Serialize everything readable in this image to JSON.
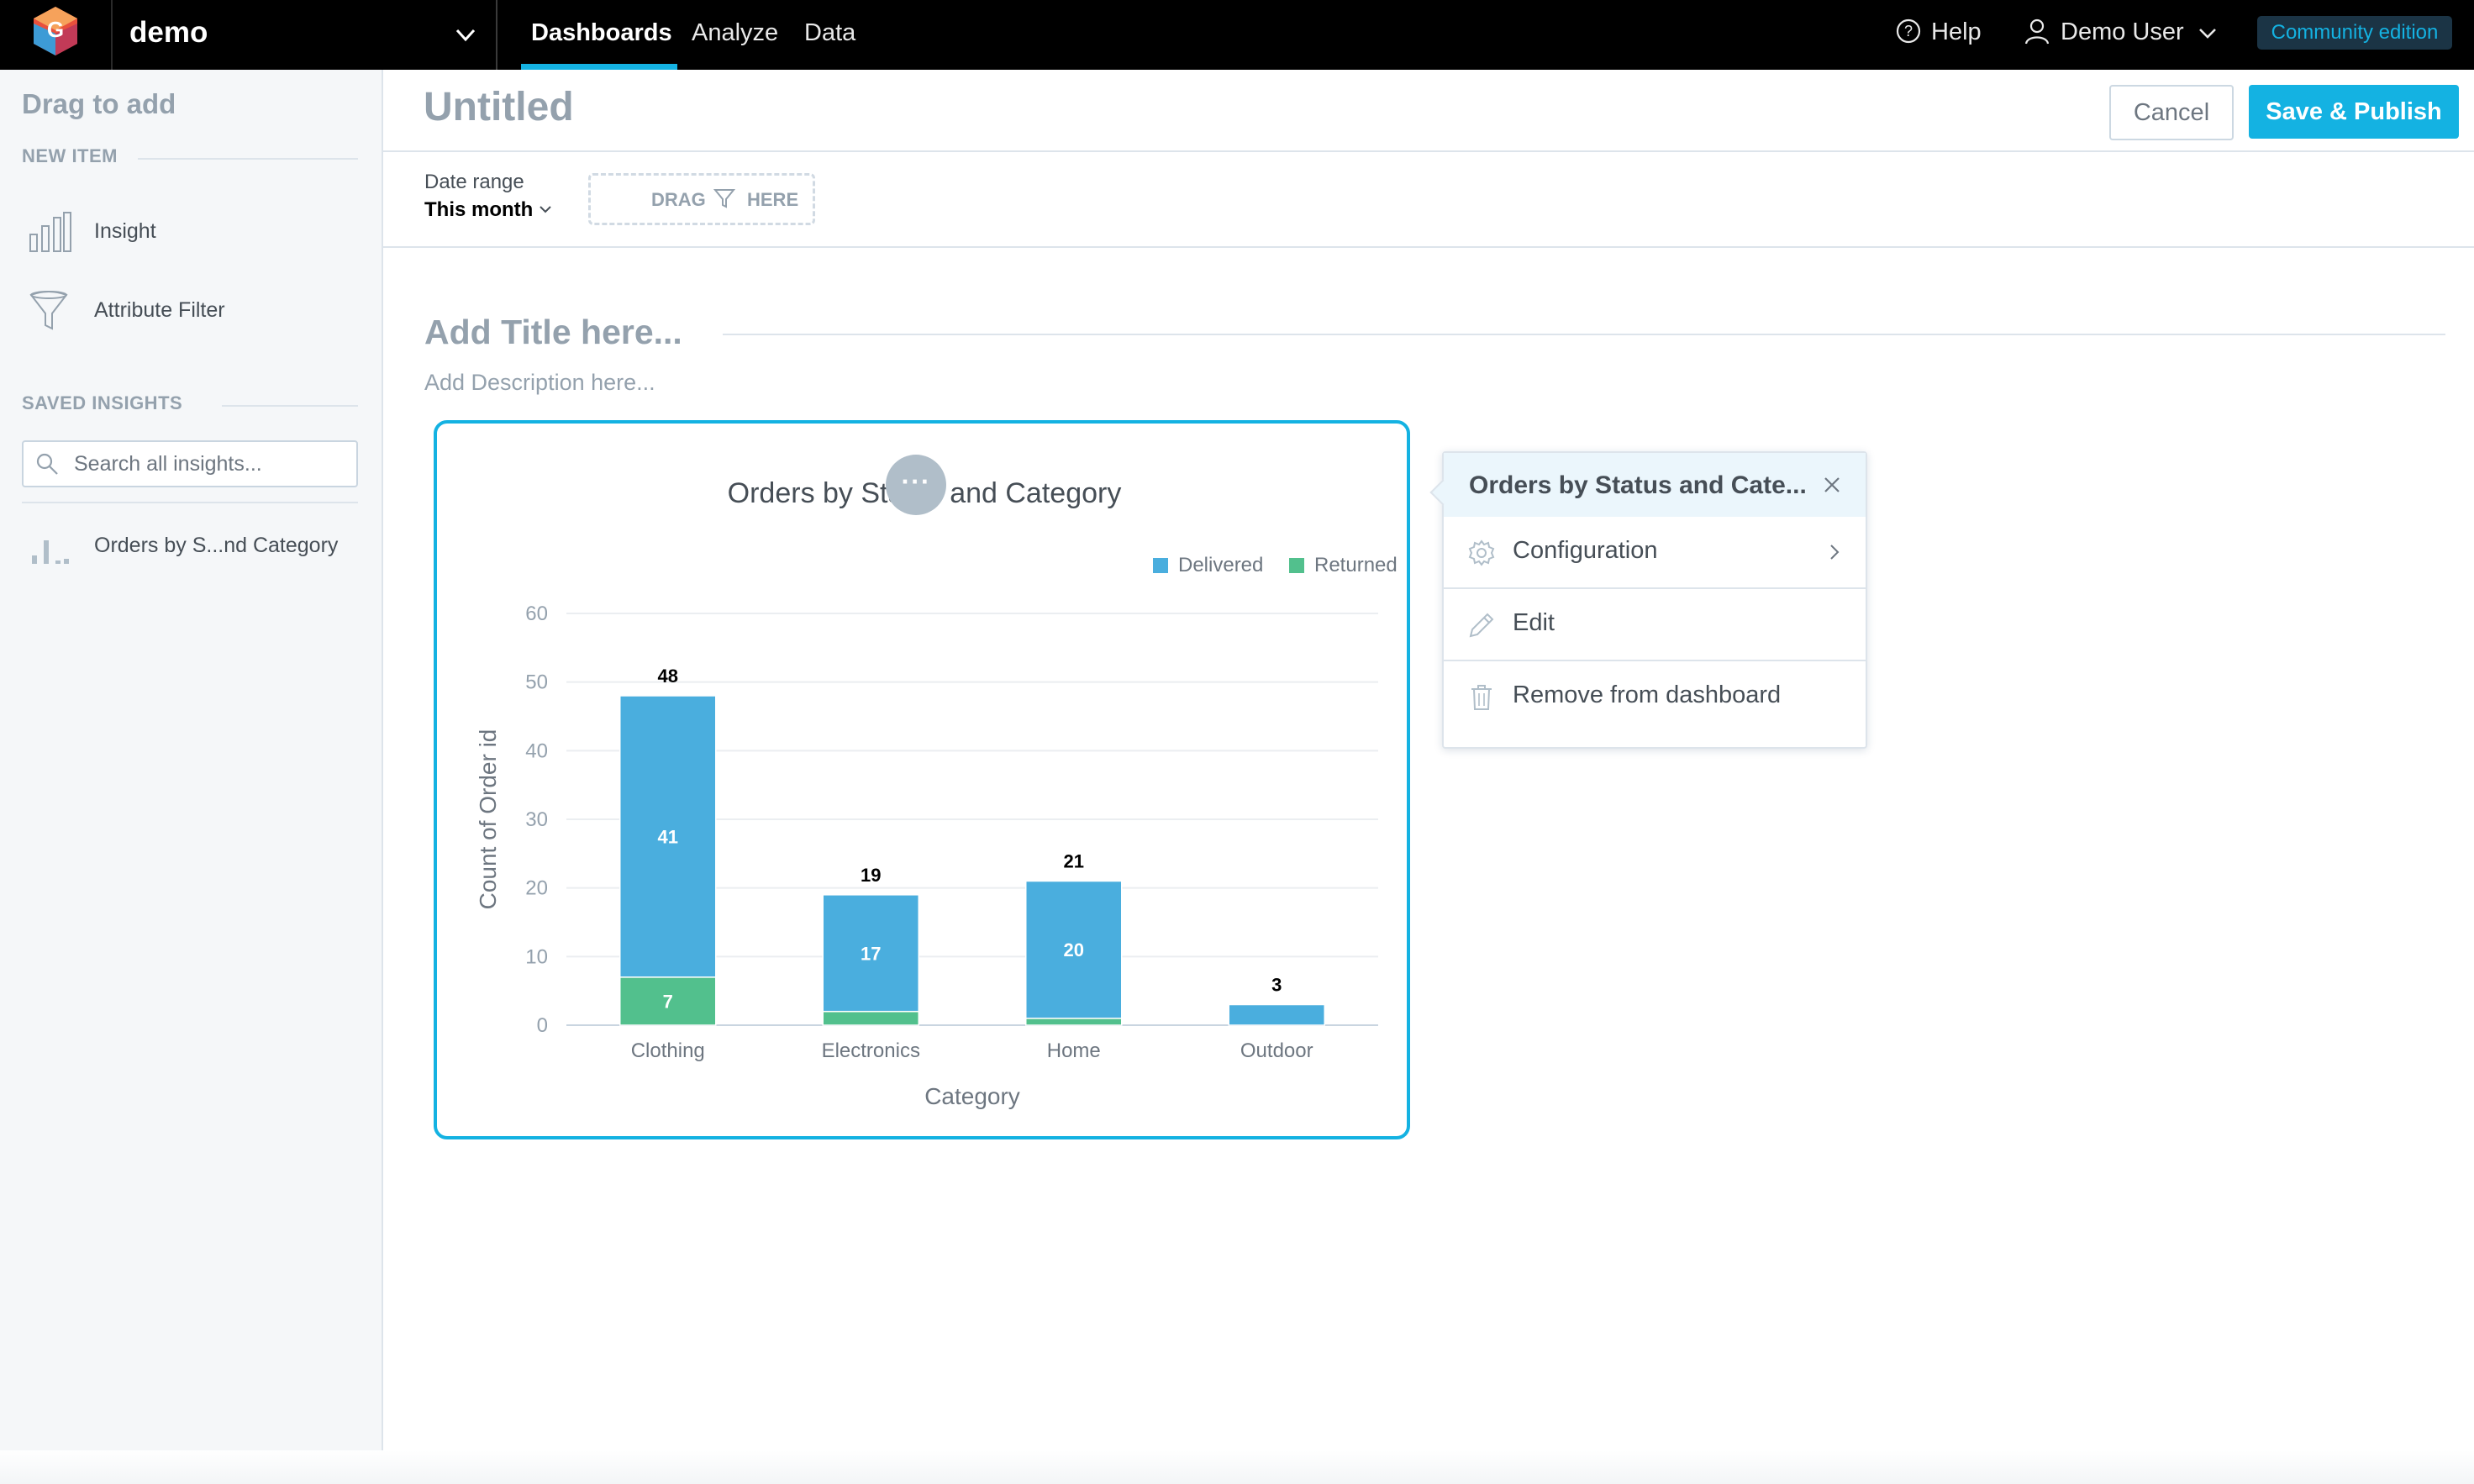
{
  "topbar": {
    "workspace": "demo",
    "tabs": [
      "Dashboards",
      "Analyze",
      "Data"
    ],
    "help": "Help",
    "user": "Demo User",
    "badge": "Community edition"
  },
  "sidebar": {
    "title": "Drag to add",
    "new_item_heading": "NEW ITEM",
    "new_items": [
      "Insight",
      "Attribute Filter"
    ],
    "saved_heading": "SAVED INSIGHTS",
    "search_placeholder": "Search all insights...",
    "saved_items": [
      "Orders by S...nd Category"
    ]
  },
  "header": {
    "title": "Untitled",
    "cancel": "Cancel",
    "save": "Save & Publish"
  },
  "filters": {
    "date_label": "Date range",
    "date_value": "This month",
    "drag_word": "DRAG",
    "here_word": "HERE"
  },
  "section": {
    "title_placeholder": "Add Title here...",
    "description_placeholder": "Add Description here..."
  },
  "widget": {
    "title": "Orders by Status and Category",
    "menu_label": "···"
  },
  "popup": {
    "title": "Orders by Status and Cate...",
    "items": [
      "Configuration",
      "Edit",
      "Remove from dashboard"
    ]
  },
  "colors": {
    "accent": "#14b2e2",
    "delivered": "#4aaede",
    "returned": "#52c08d",
    "topbar": "#000000"
  },
  "chart_data": {
    "type": "bar",
    "stacked": true,
    "categories": [
      "Clothing",
      "Electronics",
      "Home",
      "Outdoor"
    ],
    "series": [
      {
        "name": "Delivered",
        "values": [
          41,
          17,
          20,
          3
        ],
        "labels": [
          "41",
          "17",
          "20",
          ""
        ]
      },
      {
        "name": "Returned",
        "values": [
          7,
          2,
          1,
          0
        ],
        "labels": [
          "7",
          "",
          "",
          ""
        ]
      }
    ],
    "totals": [
      48,
      19,
      21,
      3
    ],
    "title": "Orders by Status and Category",
    "xlabel": "Category",
    "ylabel": "Count of Order id",
    "ylim": [
      0,
      60
    ],
    "yticks": [
      "0",
      "10",
      "20",
      "30",
      "40",
      "50",
      "60"
    ],
    "legend_position": "top-right",
    "grid": true
  }
}
